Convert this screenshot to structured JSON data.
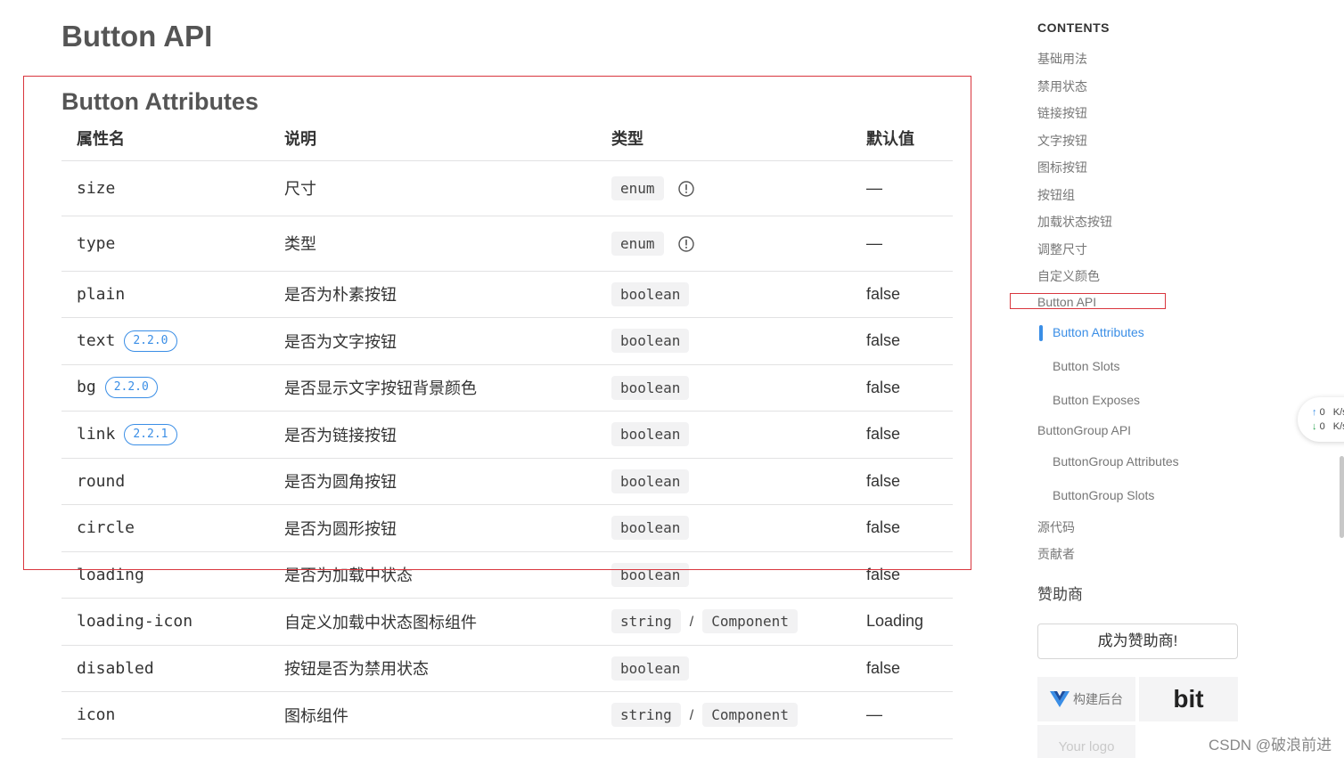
{
  "page_title": "Button API",
  "section_title": "Button Attributes",
  "table": {
    "headers": [
      "属性名",
      "说明",
      "类型",
      "默认值"
    ],
    "rows": [
      {
        "name": "size",
        "version": "",
        "desc": "尺寸",
        "types": [
          "enum"
        ],
        "info": true,
        "default": "—"
      },
      {
        "name": "type",
        "version": "",
        "desc": "类型",
        "types": [
          "enum"
        ],
        "info": true,
        "default": "—"
      },
      {
        "name": "plain",
        "version": "",
        "desc": "是否为朴素按钮",
        "types": [
          "boolean"
        ],
        "info": false,
        "default": "false"
      },
      {
        "name": "text",
        "version": "2.2.0",
        "desc": "是否为文字按钮",
        "types": [
          "boolean"
        ],
        "info": false,
        "default": "false"
      },
      {
        "name": "bg",
        "version": "2.2.0",
        "desc": "是否显示文字按钮背景颜色",
        "types": [
          "boolean"
        ],
        "info": false,
        "default": "false"
      },
      {
        "name": "link",
        "version": "2.2.1",
        "desc": "是否为链接按钮",
        "types": [
          "boolean"
        ],
        "info": false,
        "default": "false"
      },
      {
        "name": "round",
        "version": "",
        "desc": "是否为圆角按钮",
        "types": [
          "boolean"
        ],
        "info": false,
        "default": "false"
      },
      {
        "name": "circle",
        "version": "",
        "desc": "是否为圆形按钮",
        "types": [
          "boolean"
        ],
        "info": false,
        "default": "false"
      },
      {
        "name": "loading",
        "version": "",
        "desc": "是否为加载中状态",
        "types": [
          "boolean"
        ],
        "info": false,
        "default": "false"
      },
      {
        "name": "loading-icon",
        "version": "",
        "desc": "自定义加载中状态图标组件",
        "types": [
          "string",
          "Component"
        ],
        "info": false,
        "default": "Loading"
      },
      {
        "name": "disabled",
        "version": "",
        "desc": "按钮是否为禁用状态",
        "types": [
          "boolean"
        ],
        "info": false,
        "default": "false"
      },
      {
        "name": "icon",
        "version": "",
        "desc": "图标组件",
        "types": [
          "string",
          "Component"
        ],
        "info": false,
        "default": "—"
      }
    ]
  },
  "toc": {
    "heading": "CONTENTS",
    "items": [
      {
        "label": "基础用法",
        "sub": false,
        "active": false
      },
      {
        "label": "禁用状态",
        "sub": false,
        "active": false
      },
      {
        "label": "链接按钮",
        "sub": false,
        "active": false
      },
      {
        "label": "文字按钮",
        "sub": false,
        "active": false
      },
      {
        "label": "图标按钮",
        "sub": false,
        "active": false
      },
      {
        "label": "按钮组",
        "sub": false,
        "active": false
      },
      {
        "label": "加载状态按钮",
        "sub": false,
        "active": false
      },
      {
        "label": "调整尺寸",
        "sub": false,
        "active": false
      },
      {
        "label": "自定义颜色",
        "sub": false,
        "active": false
      },
      {
        "label": "Button API",
        "sub": false,
        "active": false
      },
      {
        "label": "Button Attributes",
        "sub": true,
        "active": true
      },
      {
        "label": "Button Slots",
        "sub": true,
        "active": false
      },
      {
        "label": "Button Exposes",
        "sub": true,
        "active": false
      },
      {
        "label": "ButtonGroup API",
        "sub": false,
        "active": false
      },
      {
        "label": "ButtonGroup Attributes",
        "sub": true,
        "active": false
      },
      {
        "label": "ButtonGroup Slots",
        "sub": true,
        "active": false
      },
      {
        "label": "源代码",
        "sub": false,
        "active": false
      },
      {
        "label": "贡献者",
        "sub": false,
        "active": false
      }
    ]
  },
  "sponsor": {
    "title": "赞助商",
    "button_label": "成为赞助商!",
    "vue_card_label": "构建后台",
    "bit_card_label": "bit",
    "your_logo_label": "Your logo"
  },
  "speed_widget": {
    "up": "0",
    "down": "0",
    "unit": "K/s"
  },
  "watermark": "CSDN @破浪前进",
  "colors": {
    "accent": "#3a8ee6",
    "highlight_box": "#d9363e"
  }
}
